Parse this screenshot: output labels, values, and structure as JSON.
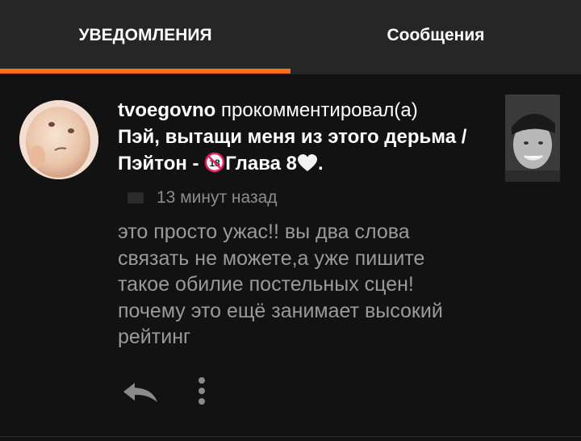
{
  "tabs": {
    "notifications": "УВЕДОМЛЕНИЯ",
    "messages": "Сообщения",
    "active_color": "#ff6c1a"
  },
  "notification": {
    "username": "tvoegovno",
    "action": "прокомментировал(а)",
    "story_title_part1": "Пэй, вытащи меня из этого дерьма /Пэйтон - ",
    "story_title_part2": "Глава 8",
    "title_end": ".",
    "time_ago": "13 минут назад",
    "comment": "это просто ужас!! вы два слова связать не можете,а уже пишите такое обилие постельных сцен! почему это ещё занимает высокий рейтинг"
  },
  "icons": {
    "age_badge": "no-under-18-icon",
    "heart": "white-heart-icon",
    "reply": "reply-arrow-icon",
    "more": "vertical-dots-icon",
    "time": "comment-icon"
  }
}
